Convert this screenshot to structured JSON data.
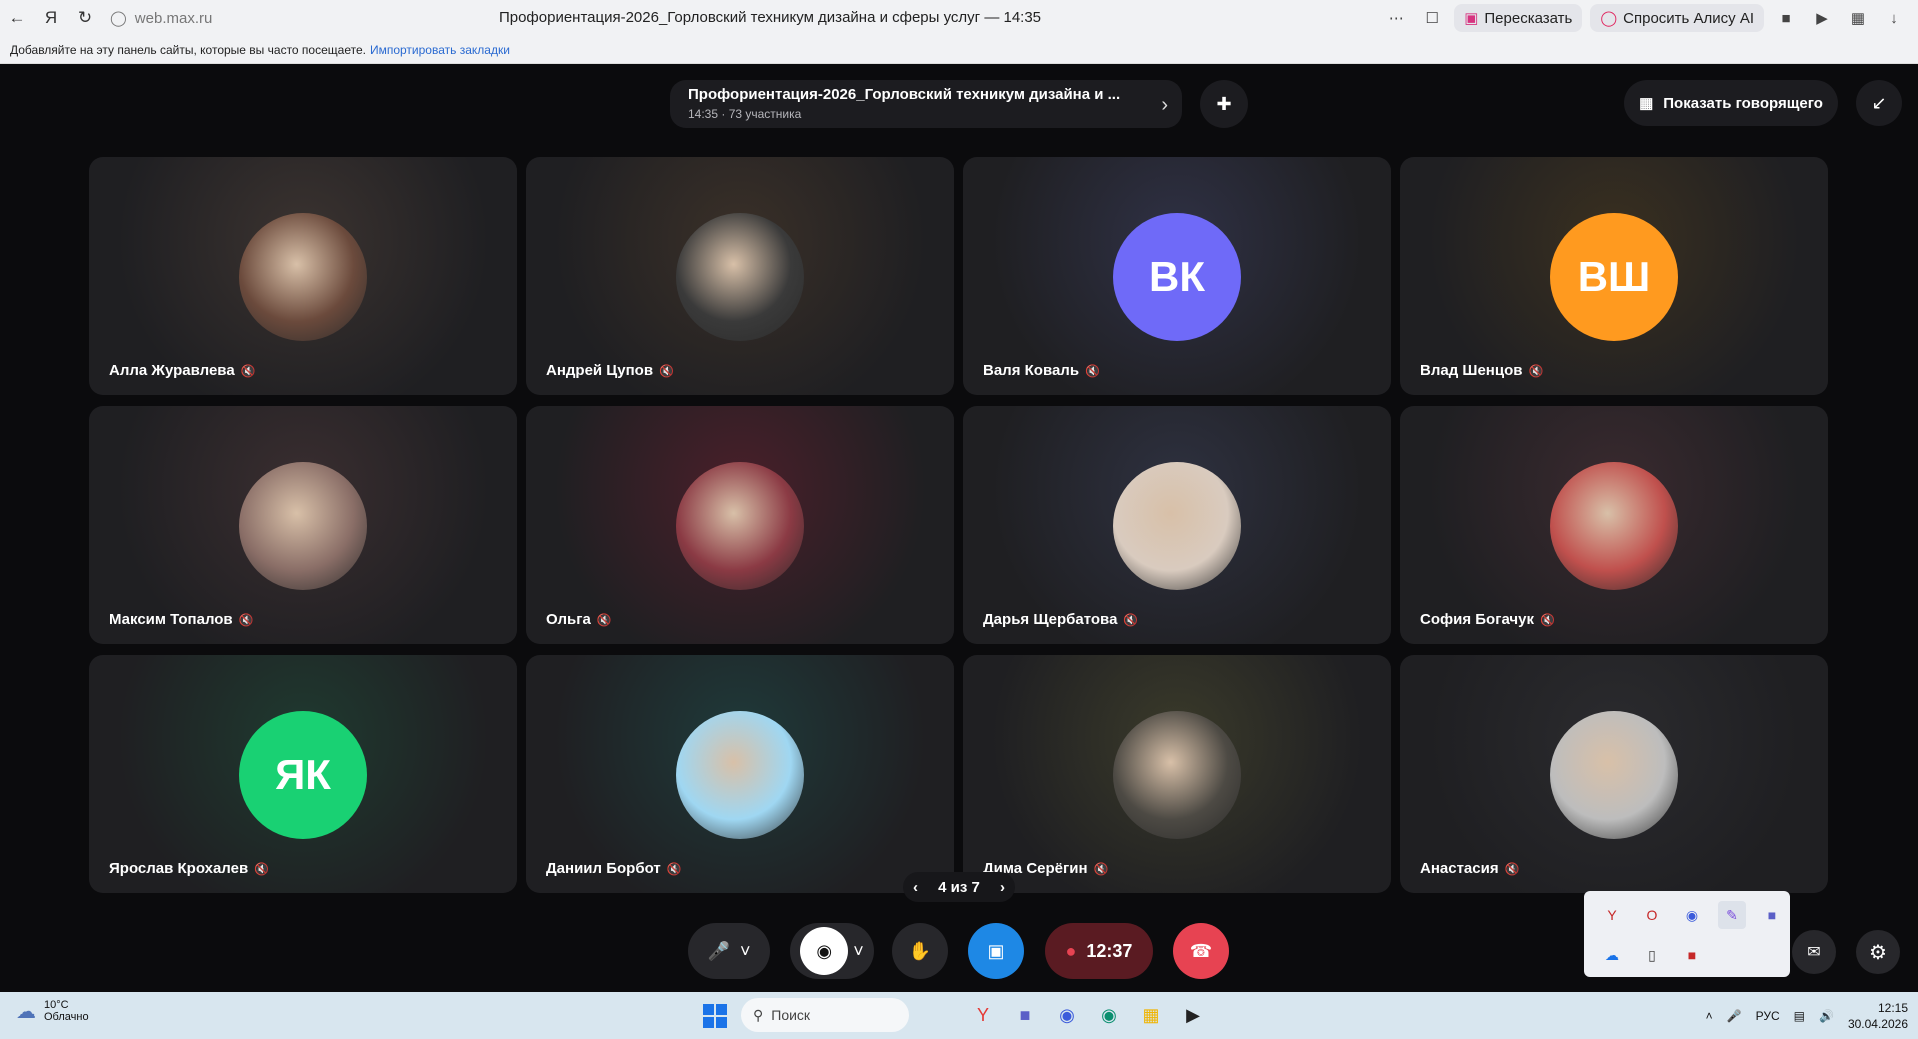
{
  "browser": {
    "url": "web.max.ru",
    "tab_title": "Профориентация-2026_Горловский техникум дизайна и сферы услуг — 14:35",
    "retell_label": "Пересказать",
    "ask_alice_label": "Спросить Алису AI",
    "bookmark_hint": "Добавляйте на эту панель сайты, которые вы часто посещаете.",
    "import_link": "Импортировать закладки"
  },
  "call": {
    "title": "Профориентация-2026_Горловский техникум дизайна и ...",
    "subtitle": "14:35 · 73 участника",
    "show_speaker_label": "Показать говорящего",
    "pager": "4 из 7",
    "timer": "12:37"
  },
  "participants": [
    {
      "name": "Алла Журавлева",
      "avatar": "photo",
      "initials": "",
      "color": "#6b4a3c"
    },
    {
      "name": "Андрей Цупов",
      "avatar": "photo",
      "initials": "",
      "color": "#3a3a3a"
    },
    {
      "name": "Валя Коваль",
      "avatar": "initials",
      "initials": "ВК",
      "color": "#6f6af8"
    },
    {
      "name": "Влад Шенцов",
      "avatar": "initials",
      "initials": "ВШ",
      "color": "#ff9a1f"
    },
    {
      "name": "Максим Топалов",
      "avatar": "photo",
      "initials": "",
      "color": "#8a6e67"
    },
    {
      "name": "Ольга",
      "avatar": "photo",
      "initials": "",
      "color": "#8b3a44"
    },
    {
      "name": "Дарья Щербатова",
      "avatar": "photo",
      "initials": "",
      "color": "#d9cbbf"
    },
    {
      "name": "София Богачук",
      "avatar": "photo",
      "initials": "",
      "color": "#c0504d"
    },
    {
      "name": "Ярослав Крохалев",
      "avatar": "initials",
      "initials": "ЯК",
      "color": "#19d173"
    },
    {
      "name": "Даниил Борбот",
      "avatar": "photo",
      "initials": "",
      "color": "#9fd7f2"
    },
    {
      "name": "Дима Серёгин",
      "avatar": "photo",
      "initials": "",
      "color": "#4d4a44"
    },
    {
      "name": "Анастасия",
      "avatar": "photo",
      "initials": "",
      "color": "#bdbdbd"
    }
  ],
  "taskbar": {
    "weather_temp": "10°C",
    "weather_desc": "Облачно",
    "search_placeholder": "Поиск",
    "lang": "РУС",
    "time": "12:15",
    "date": "30.04.2026"
  }
}
